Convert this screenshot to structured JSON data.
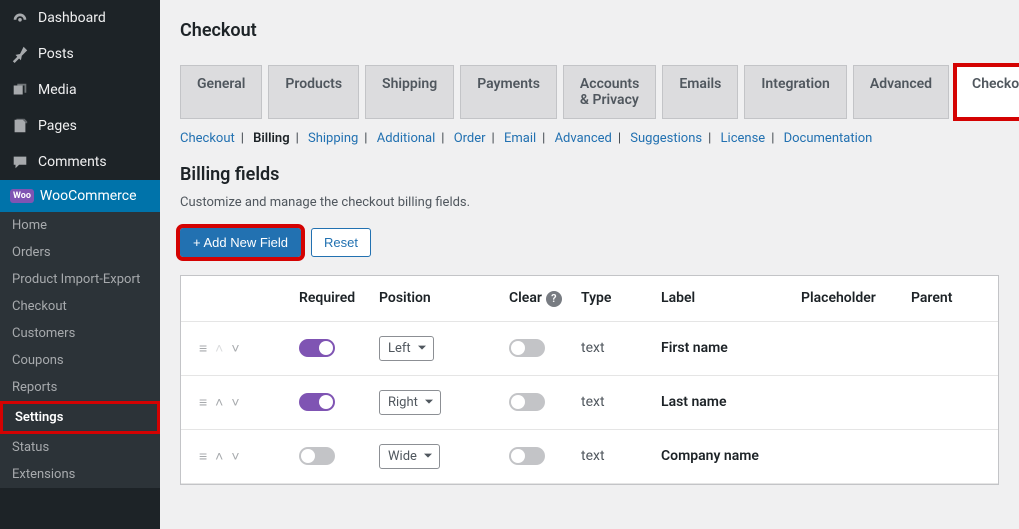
{
  "sidebar": {
    "top": [
      {
        "label": "Dashboard",
        "icon": "dashboard"
      },
      {
        "label": "Posts",
        "icon": "pin"
      },
      {
        "label": "Media",
        "icon": "media"
      },
      {
        "label": "Pages",
        "icon": "pages"
      },
      {
        "label": "Comments",
        "icon": "comments"
      }
    ],
    "active": {
      "label": "WooCommerce",
      "badge": "Woo"
    },
    "sub": [
      {
        "label": "Home"
      },
      {
        "label": "Orders"
      },
      {
        "label": "Product Import-Export"
      },
      {
        "label": "Checkout"
      },
      {
        "label": "Customers"
      },
      {
        "label": "Coupons"
      },
      {
        "label": "Reports"
      },
      {
        "label": "Settings",
        "highlighted": true
      },
      {
        "label": "Status"
      },
      {
        "label": "Extensions"
      }
    ]
  },
  "page_title": "Checkout",
  "tabs": [
    "General",
    "Products",
    "Shipping",
    "Payments",
    "Accounts & Privacy",
    "Emails",
    "Integration",
    "Advanced",
    "Checkout"
  ],
  "tabs_highlighted_index": 8,
  "subnav": [
    "Checkout",
    "Billing",
    "Shipping",
    "Additional",
    "Order",
    "Email",
    "Advanced",
    "Suggestions",
    "License",
    "Documentation"
  ],
  "subnav_current_index": 1,
  "section": {
    "title": "Billing fields",
    "desc": "Customize and manage the checkout billing fields."
  },
  "buttons": {
    "add": "+ Add New Field",
    "reset": "Reset"
  },
  "table": {
    "headers": {
      "required": "Required",
      "position": "Position",
      "clear": "Clear",
      "type": "Type",
      "label": "Label",
      "placeholder": "Placeholder",
      "parent": "Parent"
    },
    "rows": [
      {
        "required": true,
        "position": "Left",
        "clear": false,
        "type": "text",
        "label": "First name",
        "placeholder": "",
        "parent": "",
        "up_disabled": true
      },
      {
        "required": true,
        "position": "Right",
        "clear": false,
        "type": "text",
        "label": "Last name",
        "placeholder": "",
        "parent": "",
        "up_disabled": false
      },
      {
        "required": false,
        "position": "Wide",
        "clear": false,
        "type": "text",
        "label": "Company name",
        "placeholder": "",
        "parent": "",
        "up_disabled": false
      }
    ]
  }
}
